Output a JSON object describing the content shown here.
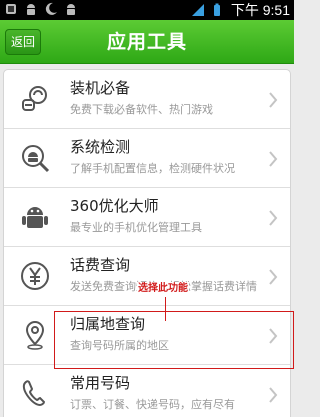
{
  "status_bar": {
    "time": "下午 9:51",
    "icons": [
      "notification-icon",
      "android-icon",
      "moon-icon",
      "android-icon",
      "signal-icon",
      "battery-icon"
    ]
  },
  "header": {
    "back_label": "返回",
    "title": "应用工具"
  },
  "items": [
    {
      "name": "装机必备",
      "desc": "免费下载必备软件、热门游戏",
      "icon": "pacifier-icon"
    },
    {
      "name": "系统检测",
      "desc": "了解手机配置信息，检测硬件状况",
      "icon": "magnifier-android-icon"
    },
    {
      "name": "360优化大师",
      "desc": "最专业的手机优化管理工具",
      "icon": "android-robot-icon"
    },
    {
      "name": "话费查询",
      "desc": "发送免费查询短信，轻松掌握话费详情",
      "icon": "yen-coin-icon"
    },
    {
      "name": "归属地查询",
      "desc": "查询号码所属的地区",
      "icon": "map-pin-icon"
    },
    {
      "name": "常用号码",
      "desc": "订票、订餐、快递号码，应有尽有",
      "icon": "phone-handset-icon"
    }
  ],
  "annotation": {
    "text": "选择此功能",
    "color": "#d11a1a"
  },
  "colors": {
    "title_bar": "#3cb521",
    "background": "#ebebeb",
    "item_title": "#222222",
    "item_desc": "#999999"
  }
}
